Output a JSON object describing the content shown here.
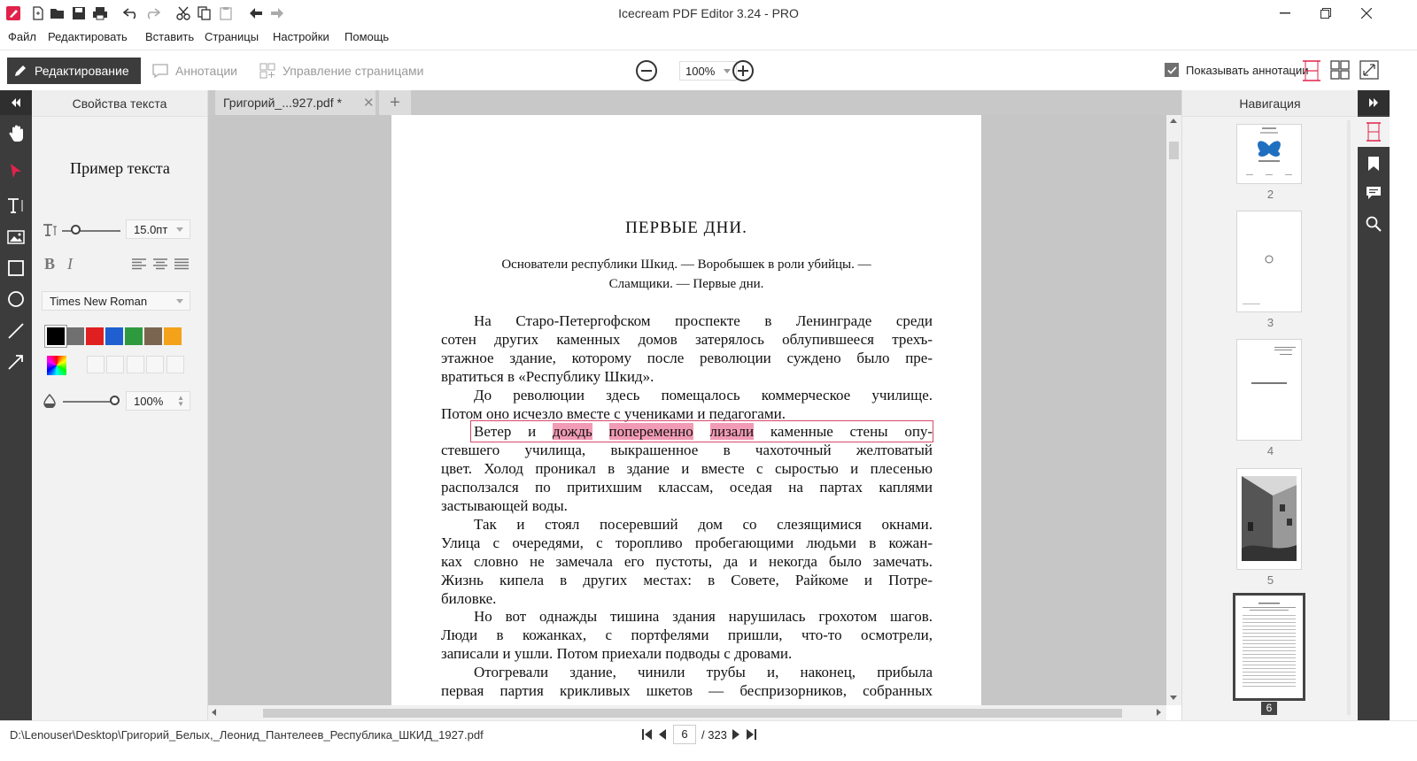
{
  "window": {
    "title": "Icecream PDF Editor 3.24 - PRO"
  },
  "menu": [
    "Файл",
    "Редактировать",
    "Вставить",
    "Страницы",
    "Настройки",
    "Помощь"
  ],
  "toolbar": {
    "modes": [
      "Редактирование",
      "Аннотации",
      "Управление страницами"
    ],
    "zoom": "100%",
    "show_annotations": "Показывать аннотации",
    "show_annotations_checked": true
  },
  "props": {
    "title": "Свойства текста",
    "sample": "Пример текста",
    "font_size": "15.0пт",
    "font_family": "Times New Roman",
    "opacity": "100%",
    "bold": "B",
    "italic": "I",
    "colors": [
      "#000000",
      "#707070",
      "#e02020",
      "#1f5fd0",
      "#2e9a3e",
      "#7a6650",
      "#f4a21a"
    ]
  },
  "tab": {
    "title": "Григорий_...927.pdf *"
  },
  "document": {
    "chapter": "ПЕРВЫЕ ДНИ.",
    "subtitle_1": "Основатели республики Шкид. — Воробышек в роли убийцы. —",
    "subtitle_2": "Сламщики. — Первые дни.",
    "lines": [
      "На Старо-Петергофском проспекте в Ленинграде среди",
      "сотен других каменных домов затерялось облупившееся трехъ-",
      "этажное здание, которому после революции суждено было пре-",
      "вратиться в «Республику Шкид».",
      "До революции здесь помещалось коммерческое училище.",
      "Потом оно исчезло вместе с учениками и педагогами.",
      "стевшего училища, выкрашенное в чахоточный желтоватый",
      "цвет. Холод проникал в здание и вместе с сыростью и плесенью",
      "расползался по притихшим классам, оседая на партах каплями",
      "застывающей воды.",
      "Так и стоял посеревший дом со слезящимися окнами.",
      "Улица с очередями, с торопливо пробегающими людьми в кожан-",
      "ках словно не замечала его пустоты, да и некогда было замечать.",
      "Жизнь кипела в других местах: в Совете, Райкоме и Потре-",
      "биловке.",
      "Но вот однажды тишина здания нарушилась грохотом шагов.",
      "Люди в кожанках, с портфелями пришли, что-то осмотрели,",
      "записали и ушли. Потом приехали подводы с дровами.",
      "Отогревали здание, чинили трубы и, наконец, прибыла",
      "первая партия крикливых шкетов — беспризорников, собранных"
    ],
    "hl_line": {
      "w1": "Ветер",
      "w2": "и",
      "w3": "дождь",
      "w4": "попеременно",
      "w5": "лизали",
      "w6": "каменные",
      "w7": "стены",
      "w8": "опу-"
    }
  },
  "navigation": {
    "title": "Навигация",
    "pages": [
      "2",
      "3",
      "4",
      "5",
      "6"
    ],
    "selected": "6"
  },
  "status": {
    "path": "D:\\Lenouser\\Desktop\\Григорий_Белых,_Леонид_Пантелеев_Республика_ШКИД_1927.pdf",
    "page": "6",
    "total": "/ 323"
  }
}
